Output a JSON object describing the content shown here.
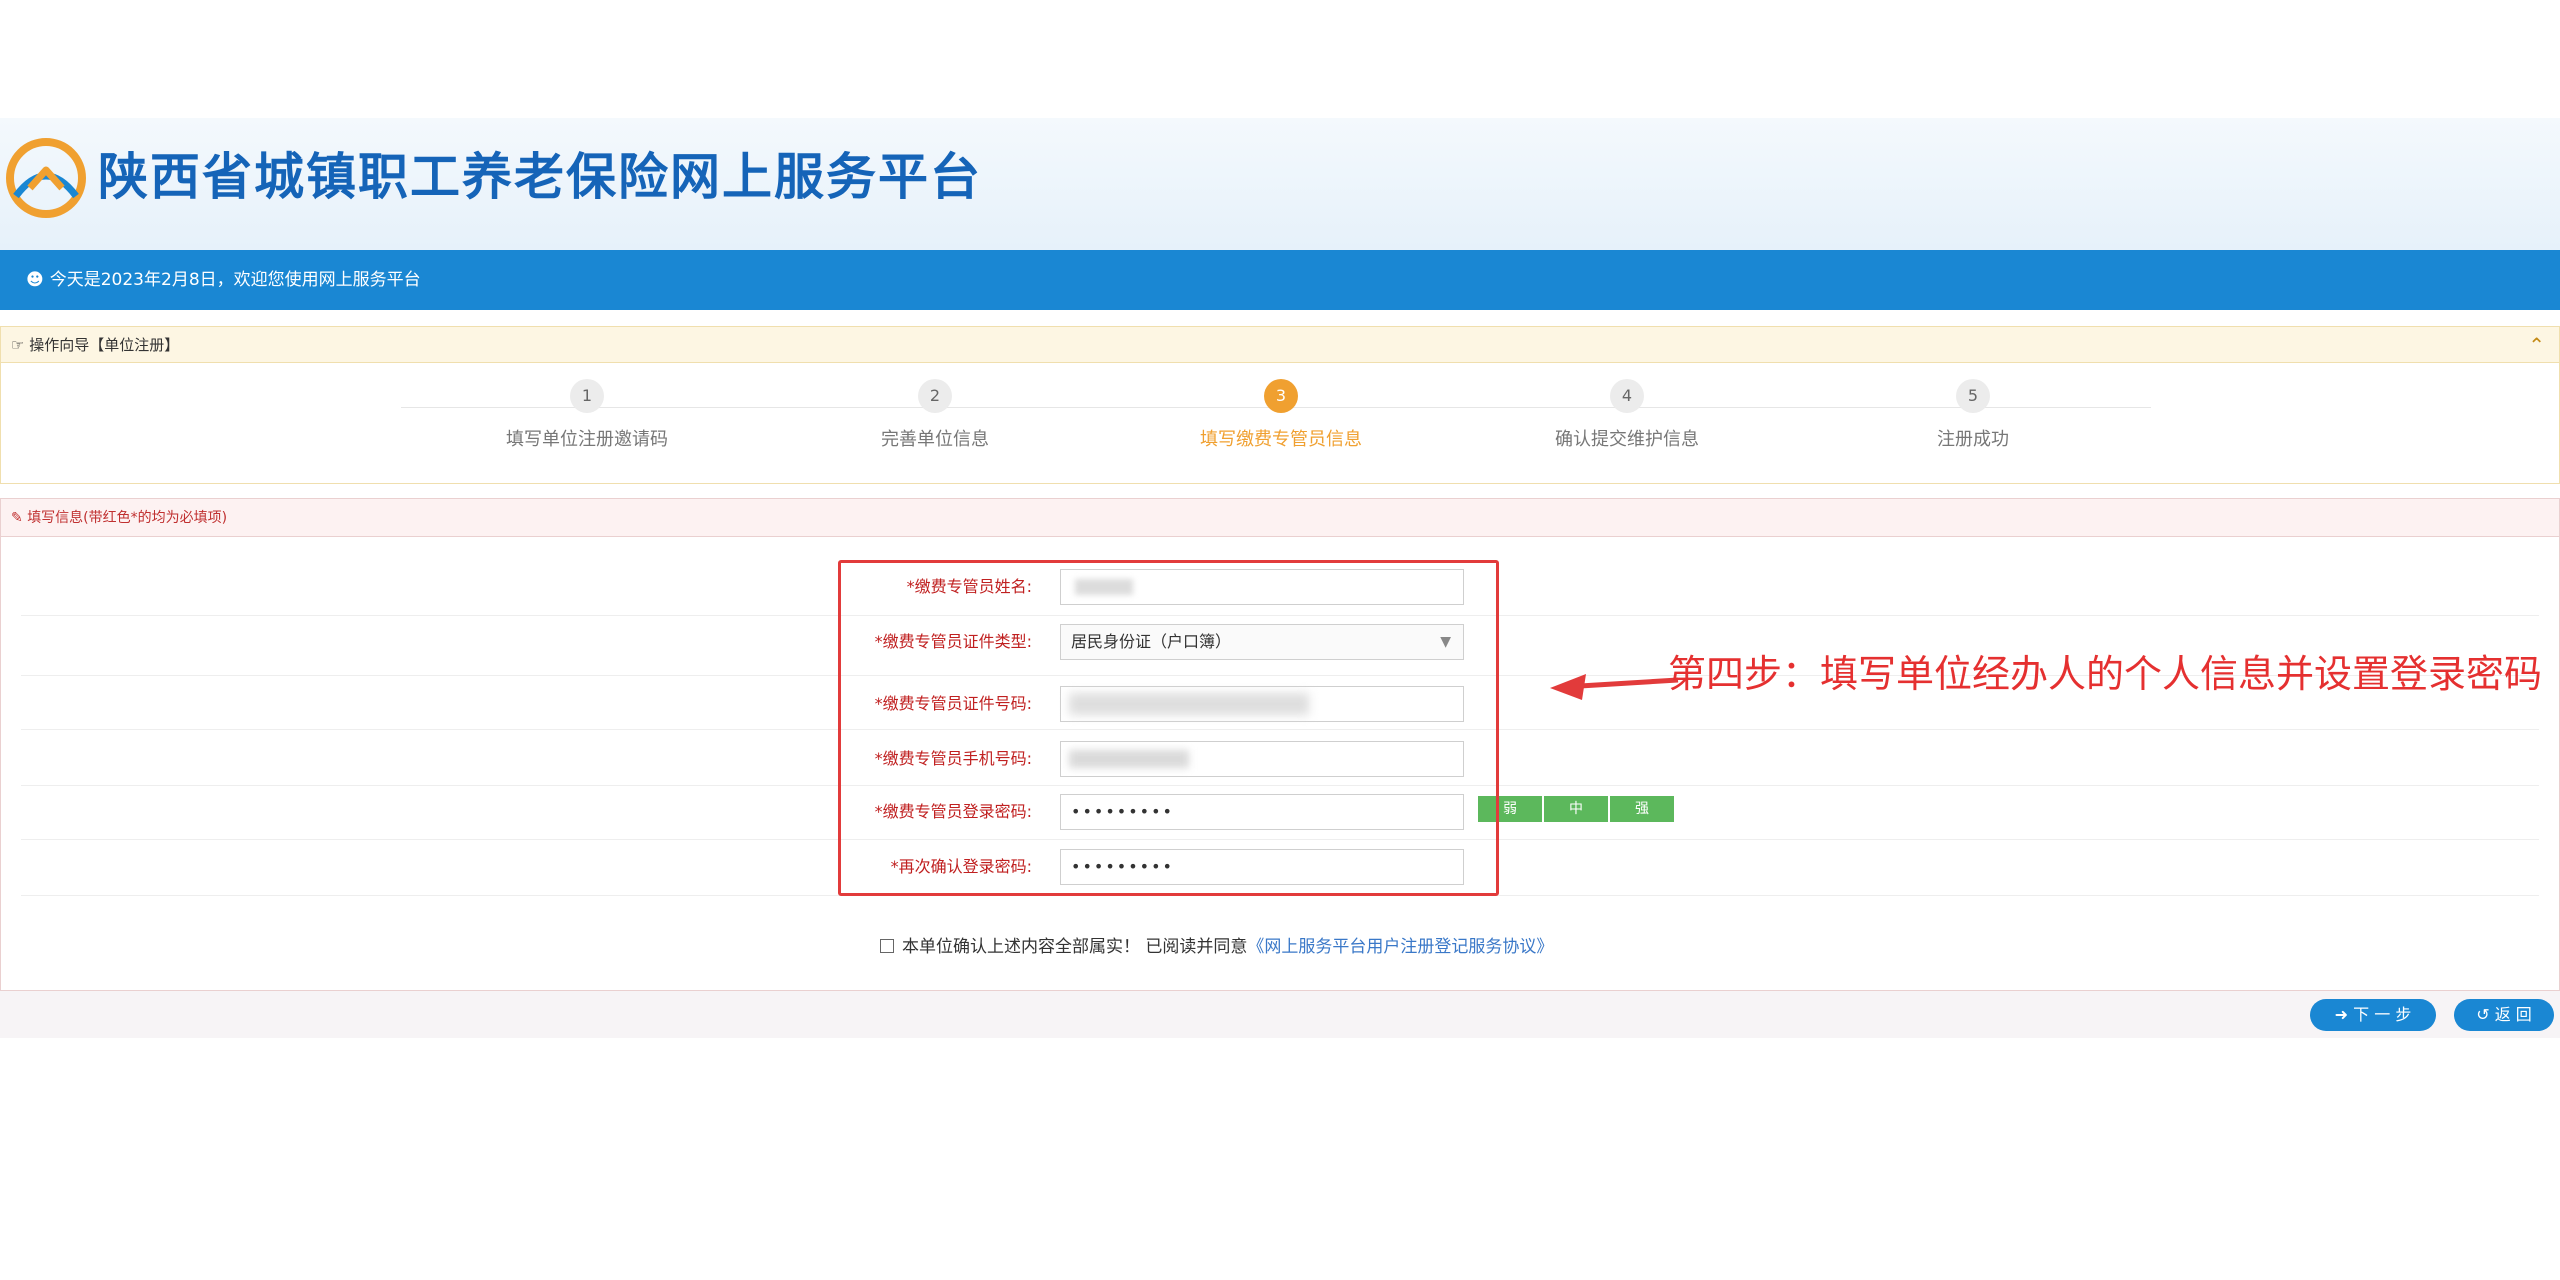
{
  "header": {
    "title": "陕西省城镇职工养老保险网上服务平台",
    "welcome": "今天是2023年2月8日，欢迎您使用网上服务平台"
  },
  "guide": {
    "title": "操作向导【单位注册】",
    "steps": [
      {
        "num": "1",
        "label": "填写单位注册邀请码"
      },
      {
        "num": "2",
        "label": "完善单位信息"
      },
      {
        "num": "3",
        "label": "填写缴费专管员信息"
      },
      {
        "num": "4",
        "label": "确认提交维护信息"
      },
      {
        "num": "5",
        "label": "注册成功"
      }
    ],
    "active_step": 3
  },
  "form": {
    "title": "填写信息(带红色*的均为必填项)",
    "fields": [
      {
        "label": "*缴费专管员姓名:",
        "value": ""
      },
      {
        "label": "*缴费专管员证件类型:",
        "value": "居民身份证（户口簿）"
      },
      {
        "label": "*缴费专管员证件号码:",
        "value": ""
      },
      {
        "label": "*缴费专管员手机号码:",
        "value": ""
      },
      {
        "label": "*缴费专管员登录密码:",
        "value": "•••••••••"
      },
      {
        "label": "*再次确认登录密码:",
        "value": "•••••••••"
      }
    ],
    "strength": [
      "弱",
      "中",
      "强"
    ],
    "agree_text": "本单位确认上述内容全部属实！ 已阅读并同意",
    "agree_link": "《网上服务平台用户注册登记服务协议》"
  },
  "annotation": "第四步：填写单位经办人的个人信息并设置登录密码",
  "buttons": {
    "next": "➜ 下 一 步",
    "back": "↺ 返 回"
  },
  "colors": {
    "primary": "#1a87d3",
    "title": "#1564b8",
    "active": "#f0a030",
    "required": "#c02020",
    "annotation": "#e53030",
    "strength": "#5cb85c"
  }
}
